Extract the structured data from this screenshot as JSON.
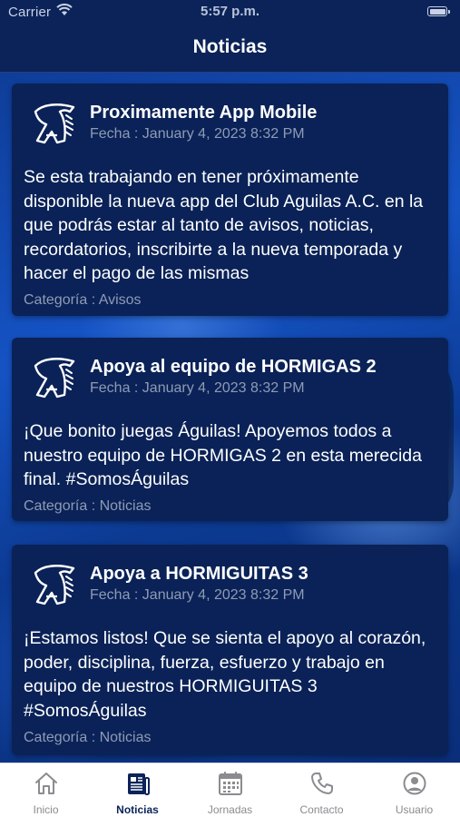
{
  "status_bar": {
    "carrier": "Carrier",
    "time": "5:57 p.m."
  },
  "header": {
    "title": "Noticias"
  },
  "posts": [
    {
      "title": "Proximamente App Mobile",
      "date": "Fecha : January 4, 2023 8:32 PM",
      "body": "Se esta trabajando en tener próximamente disponible la nueva app del Club Aguilas A.C. en la que podrás estar al tanto de avisos, noticias, recordatorios, inscribirte a la nueva temporada y hacer el pago de las mismas",
      "category": "Categoría : Avisos"
    },
    {
      "title": "Apoya al equipo de HORMIGAS 2",
      "date": "Fecha : January 4, 2023 8:32 PM",
      "body": "¡Que bonito juegas Águilas!  Apoyemos todos a nuestro equipo de HORMIGAS 2 en esta merecida final. #SomosÁguilas",
      "category": "Categoría : Noticias"
    },
    {
      "title": "Apoya a HORMIGUITAS 3",
      "date": "Fecha : January 4, 2023 8:32 PM",
      "body": "¡Estamos listos! Que se sienta el apoyo al corazón, poder, disciplina,  fuerza, esfuerzo y trabajo en equipo de nuestros HORMIGUITAS 3 #SomosÁguilas",
      "category": "Categoría : Noticias"
    }
  ],
  "tabbar": {
    "tabs": [
      {
        "label": "Inicio",
        "icon": "home-icon"
      },
      {
        "label": "Noticias",
        "icon": "newspaper-icon",
        "active": true
      },
      {
        "label": "Jornadas",
        "icon": "calendar-icon"
      },
      {
        "label": "Contacto",
        "icon": "phone-icon"
      },
      {
        "label": "Usuario",
        "icon": "user-icon"
      }
    ]
  },
  "colors": {
    "header_bg": "#0b2358",
    "card_bg": "#0a2257",
    "accent_blue": "#1553c4",
    "muted_text": "#8f9bb5",
    "tab_active": "#0b2358",
    "tab_inactive": "#8b8b90"
  }
}
